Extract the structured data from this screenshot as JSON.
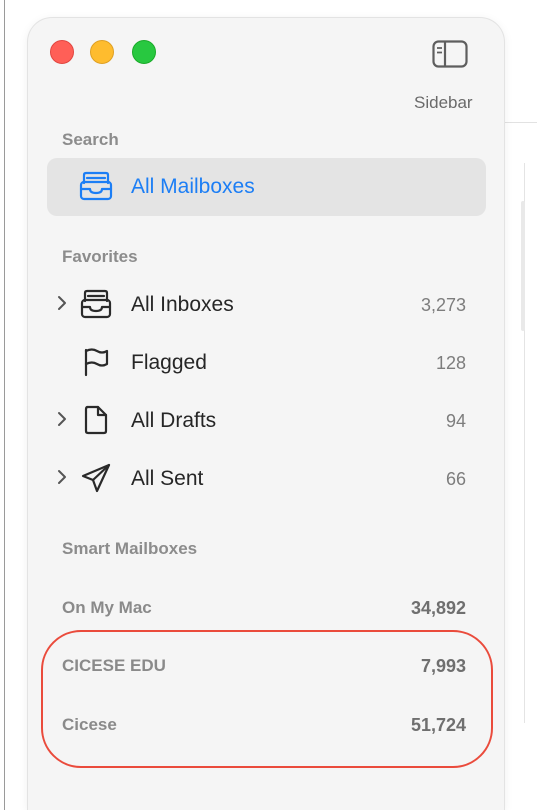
{
  "toolbar": {
    "sidebar_label": "Sidebar",
    "icons": [
      "close-button",
      "minimize-button",
      "zoom-button",
      "sidebar-toggle-icon"
    ]
  },
  "sidebar": {
    "search": {
      "header": "Search",
      "item": {
        "label": "All Mailboxes",
        "icon": "mailbox-stack-icon",
        "selected": true
      }
    },
    "favorites": {
      "header": "Favorites",
      "items": [
        {
          "label": "All Inboxes",
          "count": "3,273",
          "icon": "inbox-tray-icon",
          "expandable": true
        },
        {
          "label": "Flagged",
          "count": "128",
          "icon": "flag-icon",
          "expandable": false
        },
        {
          "label": "All Drafts",
          "count": "94",
          "icon": "document-icon",
          "expandable": true
        },
        {
          "label": "All Sent",
          "count": "66",
          "icon": "paper-plane-icon",
          "expandable": true
        }
      ]
    },
    "smart_mailboxes": {
      "header": "Smart Mailboxes"
    },
    "accounts": [
      {
        "label": "On My Mac",
        "count": "34,892"
      },
      {
        "label": "CICESE EDU",
        "count": "7,993"
      },
      {
        "label": "Cicese",
        "count": "51,724"
      }
    ]
  },
  "colors": {
    "accent": "#1c7ef5",
    "selection_bg": "#e4e4e4",
    "annotation": "#ea4b3c",
    "close": "#ff5f57",
    "minimize": "#febc2e",
    "zoom": "#28c840"
  }
}
